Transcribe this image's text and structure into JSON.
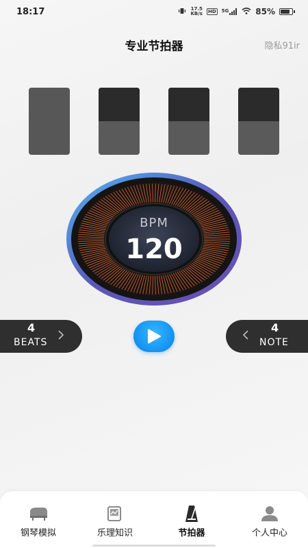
{
  "status_bar": {
    "time": "18:17",
    "net_speed_value": "17.5",
    "net_speed_unit": "KB/s",
    "hd_badge": "HD",
    "signal_badge": "5G",
    "battery_percent": "85%",
    "battery_level": 0.85
  },
  "header": {
    "title": "专业节拍器",
    "privacy_link": "隐私91ir"
  },
  "beat_indicators": [
    {
      "state": "active"
    },
    {
      "state": "inactive"
    },
    {
      "state": "inactive"
    },
    {
      "state": "inactive"
    }
  ],
  "metronome": {
    "bpm_label": "BPM",
    "bpm_value": "120"
  },
  "controls": {
    "beats_value": "4",
    "beats_label": "BEATS",
    "note_value": "4",
    "note_label": "NOTE"
  },
  "bottom_nav": {
    "items": [
      {
        "label": "钢琴模拟",
        "icon": "piano-icon"
      },
      {
        "label": "乐理知识",
        "icon": "book-icon"
      },
      {
        "label": "节拍器",
        "icon": "metronome-icon",
        "active": true
      },
      {
        "label": "个人中心",
        "icon": "person-icon"
      }
    ]
  },
  "colors": {
    "accent_blue": "#1492f2",
    "dial_orange": "#d2693c",
    "dial_ring": "#5a58b8",
    "dark_pill": "#2f2f2f"
  }
}
